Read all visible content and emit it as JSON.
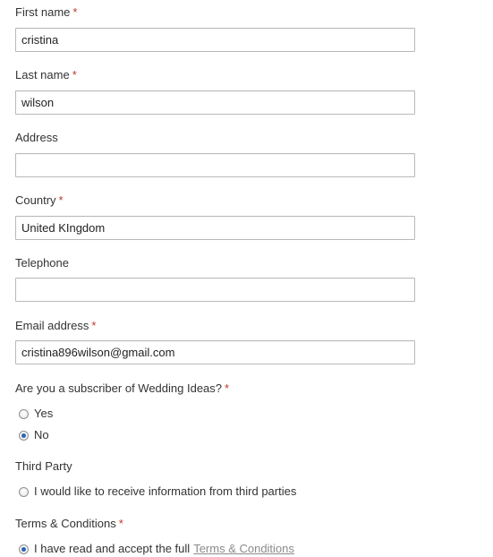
{
  "required_marker": "*",
  "fields": {
    "first_name": {
      "label": "First name",
      "value": "cristina"
    },
    "last_name": {
      "label": "Last name",
      "value": "wilson"
    },
    "address": {
      "label": "Address",
      "value": ""
    },
    "country": {
      "label": "Country",
      "value": "United KIngdom"
    },
    "telephone": {
      "label": "Telephone",
      "value": ""
    },
    "email": {
      "label": "Email address",
      "value": "cristina896wilson@gmail.com"
    }
  },
  "subscriber": {
    "question": "Are you a subscriber of Wedding Ideas?",
    "options": [
      {
        "label": "Yes",
        "selected": false
      },
      {
        "label": "No",
        "selected": true
      }
    ]
  },
  "third_party": {
    "label": "Third Party",
    "option_label": "I would like to receive information from third parties",
    "selected": false
  },
  "terms": {
    "label": "Terms & Conditions",
    "option_label": "I have read and accept the full",
    "link_text": "Terms & Conditions",
    "selected": true
  },
  "colors": {
    "required": "#c0392b",
    "radio_checked": "#2f63b5",
    "link": "#8a8a8a",
    "input_border": "#b9b9b9"
  }
}
